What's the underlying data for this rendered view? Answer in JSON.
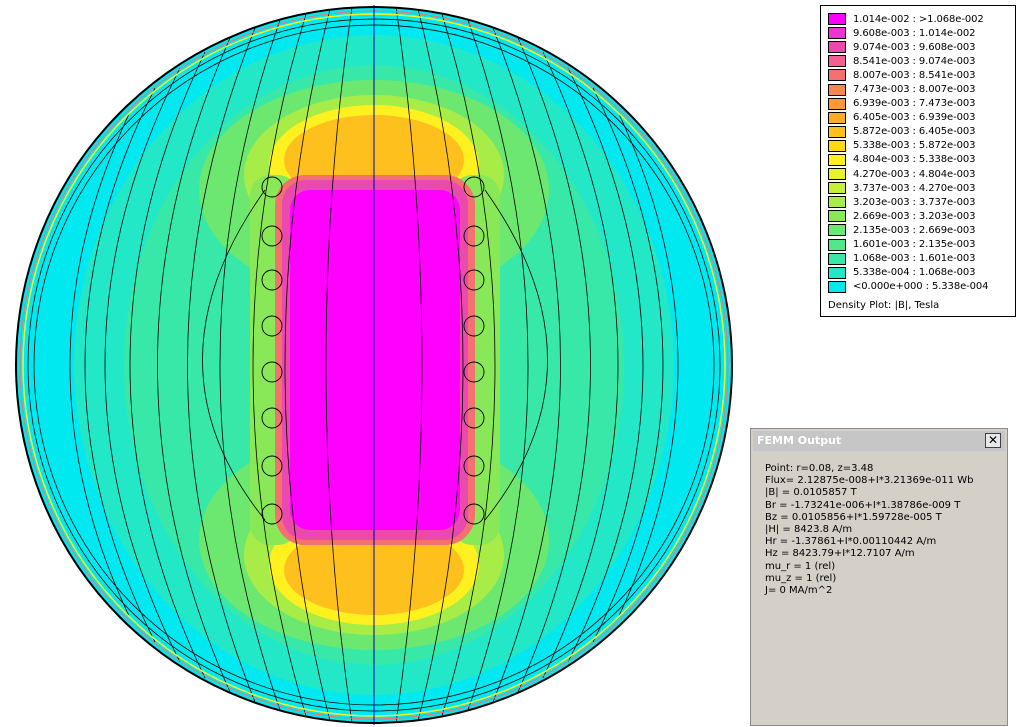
{
  "legend": {
    "rows": [
      {
        "label": "1.014e-002 : >1.068e-002",
        "color": "#ff00ff"
      },
      {
        "label": "9.608e-003 : 1.014e-002",
        "color": "#ef33ce"
      },
      {
        "label": "9.074e-003 : 9.608e-003",
        "color": "#ea4aae"
      },
      {
        "label": "8.541e-003 : 9.074e-003",
        "color": "#f06090"
      },
      {
        "label": "8.007e-003 : 8.541e-003",
        "color": "#f57070"
      },
      {
        "label": "7.473e-003 : 8.007e-003",
        "color": "#f98450"
      },
      {
        "label": "6.939e-003 : 7.473e-003",
        "color": "#fc9838"
      },
      {
        "label": "6.405e-003 : 6.939e-003",
        "color": "#fdab28"
      },
      {
        "label": "5.872e-003 : 6.405e-003",
        "color": "#fec01c"
      },
      {
        "label": "5.338e-003 : 5.872e-003",
        "color": "#ffd818"
      },
      {
        "label": "4.804e-003 : 5.338e-003",
        "color": "#fff020"
      },
      {
        "label": "4.270e-003 : 4.804e-003",
        "color": "#e8f428"
      },
      {
        "label": "3.737e-003 : 4.270e-003",
        "color": "#c8f038"
      },
      {
        "label": "3.203e-003 : 3.737e-003",
        "color": "#a8ec48"
      },
      {
        "label": "2.669e-003 : 3.203e-003",
        "color": "#88e858"
      },
      {
        "label": "2.135e-003 : 2.669e-003",
        "color": "#6ce870"
      },
      {
        "label": "1.601e-003 : 2.135e-003",
        "color": "#50e888"
      },
      {
        "label": "1.068e-003 : 1.601e-003",
        "color": "#38e8a8"
      },
      {
        "label": "5.338e-004 : 1.068e-003",
        "color": "#22e8c8"
      },
      {
        "label": "<0.000e+000 : 5.338e-004",
        "color": "#00e8f0"
      }
    ],
    "caption": "Density Plot: |B|, Tesla"
  },
  "femm_output": {
    "title": "FEMM Output",
    "close": "✕",
    "lines": [
      "Point: r=0.08, z=3.48",
      "Flux= 2.12875e-008+I*3.21369e-011 Wb",
      "|B| = 0.0105857 T",
      "Br  = -1.73241e-006+I*1.38786e-009 T",
      "Bz  = 0.0105856+I*1.59728e-005 T",
      "|H| = 8423.8 A/m",
      "Hr  = -1.37861+I*0.00110442 A/m",
      "Hz  = 8423.79+I*12.7107 A/m",
      "mu_r = 1 (rel)",
      "mu_z = 1 (rel)",
      "J= 0 MA/m^2"
    ]
  },
  "plot": {
    "colors": {
      "outer": "#00e8f0",
      "aqua": "#22e8c8",
      "mint": "#38e8a8",
      "green": "#6ce870",
      "yellow": "#fff020",
      "orange": "#fdab28",
      "pink": "#f06090",
      "magenta": "#ff00ff"
    }
  }
}
